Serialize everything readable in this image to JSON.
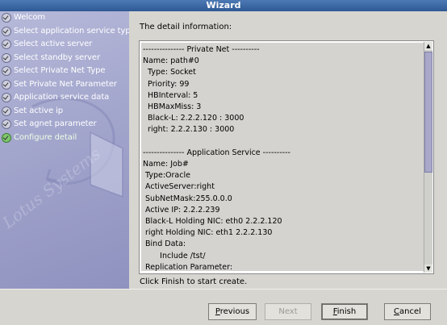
{
  "window": {
    "title": "Wizard"
  },
  "sidebar": {
    "watermark": "Lotus Systems",
    "steps": [
      {
        "label": "Welcom",
        "current": false
      },
      {
        "label": "Select application service type",
        "current": false
      },
      {
        "label": "Select active server",
        "current": false
      },
      {
        "label": "Select standby server",
        "current": false
      },
      {
        "label": "Select Private Net Type",
        "current": false
      },
      {
        "label": "Set Private Net Parameter",
        "current": false
      },
      {
        "label": "Application service data",
        "current": false
      },
      {
        "label": "Set active ip",
        "current": false
      },
      {
        "label": "Set agnet parameter",
        "current": false
      },
      {
        "label": "Configure detail",
        "current": true
      }
    ]
  },
  "main": {
    "detail_label": "The detail information:",
    "detail_text": "--------------- Private Net ----------\nName: path#0\n  Type: Socket\n  Priority: 99\n  HBInterval: 5\n  HBMaxMiss: 3\n  Black-L: 2.2.2.120 : 3000\n  right: 2.2.2.130 : 3000\n\n--------------- Application Service ----------\nName: Job#\n Type:Oracle\n ActiveServer:right\n SubNetMask:255.0.0.0\n Active IP: 2.2.2.239\n Black-L Holding NIC: eth0 2.2.2.120\n right Holding NIC: eth1 2.2.2.130\n Bind Data:\n       Include /tst/\n Replication Parameter:",
    "finish_hint": "Click Finish to start create."
  },
  "buttons": {
    "previous": {
      "label": "Previous",
      "underline": "P",
      "rest": "revious"
    },
    "next": {
      "label": "Next"
    },
    "finish": {
      "label": "Finish",
      "underline": "F",
      "rest": "inish"
    },
    "cancel": {
      "label": "Cancel",
      "underline": "C",
      "rest": "ancel"
    }
  }
}
